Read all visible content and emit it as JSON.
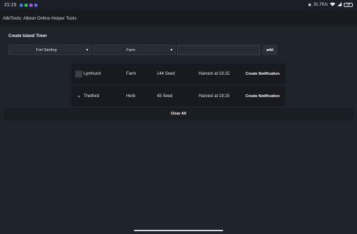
{
  "status_bar": {
    "time": "21:15",
    "network_speed": "31.7K/s",
    "battery_level": "38",
    "notification_dot_colors": [
      "#3b82f6",
      "#22c55e",
      "#a855f7",
      "#6366f1"
    ]
  },
  "app": {
    "title": "AlbiTools: Albion Online Helper Tools"
  },
  "form": {
    "section_title": "Create Island Timer",
    "city_select_value": "Fort Sterling",
    "type_select_value": "Farm",
    "amount_value": "",
    "add_label": "add"
  },
  "timers": [
    {
      "city": "Lymhurst",
      "type": "Farm",
      "seed": "144 Seed",
      "harvest": "Harvest at 19:15",
      "action_label": "Create Notification"
    },
    {
      "city": "Thetford",
      "type": "Herb",
      "seed": "45 Seed",
      "harvest": "Harvest at 19:15",
      "action_label": "Create Notification"
    }
  ],
  "clear_all_label": "Clear All"
}
